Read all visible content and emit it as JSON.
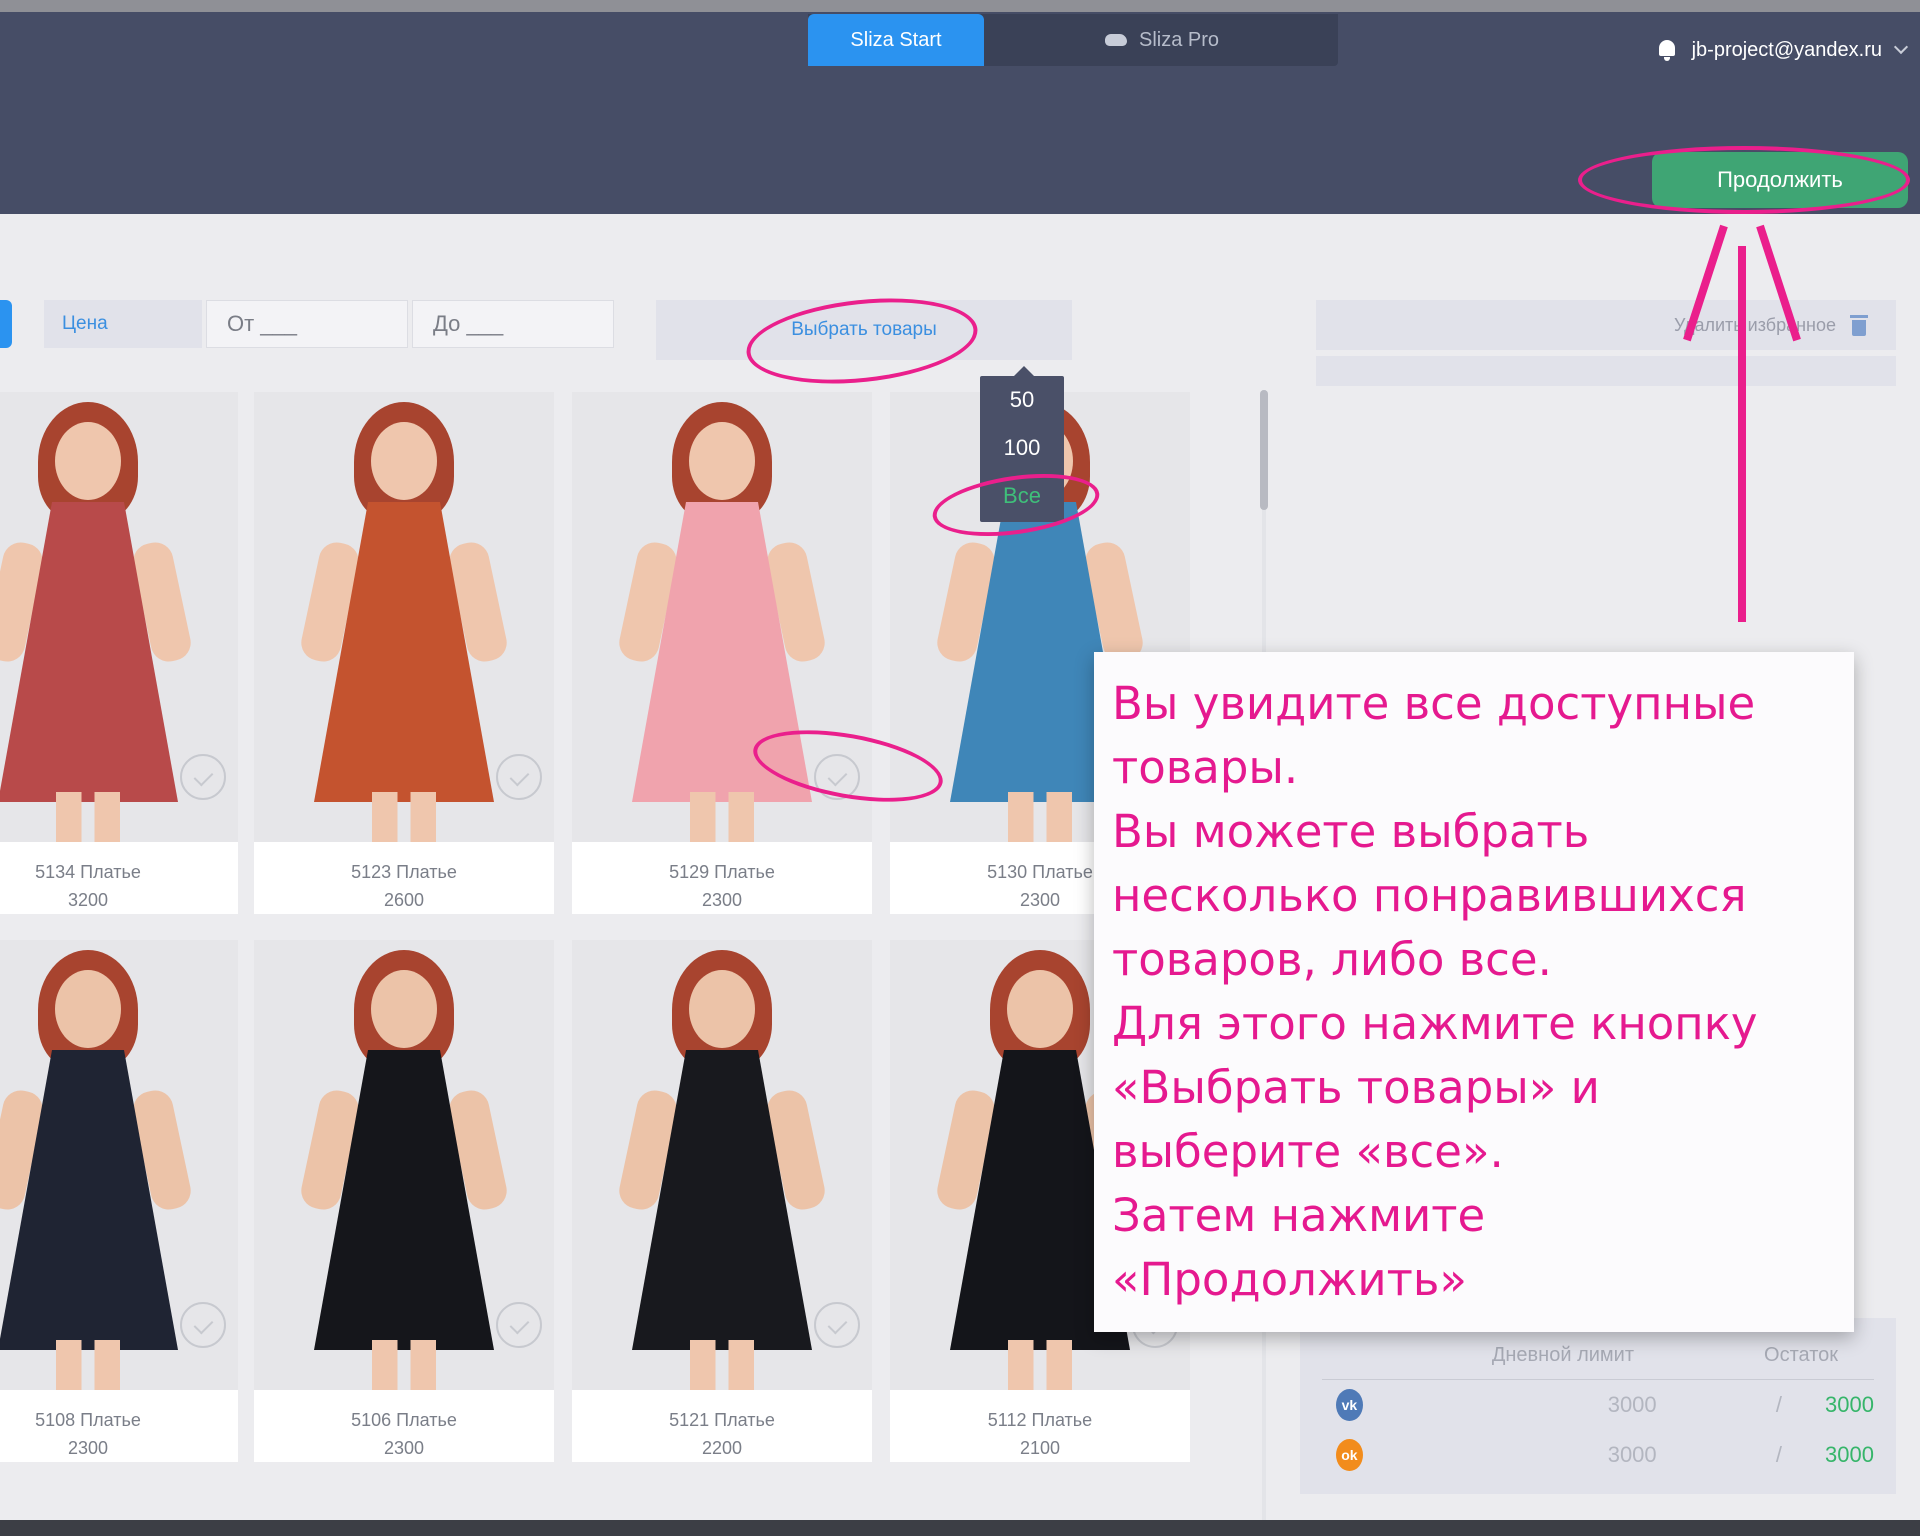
{
  "header": {
    "tabs": [
      {
        "label": "Sliza Start",
        "active": true
      },
      {
        "label": "Sliza Pro",
        "active": false,
        "icon": "cloud-icon"
      }
    ],
    "user_email": "jb-project@yandex.ru",
    "continue_label": "Продолжить"
  },
  "filters": {
    "price_label": "Цена",
    "from_placeholder": "От ___",
    "to_placeholder": "До ___",
    "select_products_label": "Выбрать товары"
  },
  "dropdown": {
    "options": [
      "50",
      "100",
      "Все"
    ],
    "selected": "Все"
  },
  "right_panel": {
    "delete_selected_label": "Удалить избранное"
  },
  "limits": {
    "col_daily": "Дневной лимит",
    "col_rest": "Остаток",
    "rows": [
      {
        "network": "vk-icon",
        "daily": "3000",
        "sep": "/",
        "rest": "3000"
      },
      {
        "network": "ok-icon",
        "daily": "3000",
        "sep": "/",
        "rest": "3000"
      }
    ]
  },
  "products": [
    {
      "name": "5134 Платье",
      "price": "3200",
      "color": "#b84a4a"
    },
    {
      "name": "5123 Платье",
      "price": "2600",
      "color": "#c4532f"
    },
    {
      "name": "5129 Платье",
      "price": "2300",
      "color": "#f0a3ad"
    },
    {
      "name": "5130 Платье",
      "price": "2300",
      "color": "#3f86b8"
    },
    {
      "name": "5108 Платье",
      "price": "2300",
      "color": "#1f2433"
    },
    {
      "name": "5106 Платье",
      "price": "2300",
      "color": "#15161b"
    },
    {
      "name": "5121 Платье",
      "price": "2200",
      "color": "#18191e"
    },
    {
      "name": "5112 Платье",
      "price": "2100",
      "color": "#14151a"
    }
  ],
  "callout": {
    "lines": [
      "Вы увидите все доступные",
      "товары.",
      "Вы можете выбрать",
      "несколько понравившихся",
      "товаров, либо все.",
      "Для этого нажмите кнопку",
      "«Выбрать товары» и",
      "выберите «все».",
      "Затем нажмите",
      "«Продолжить»"
    ]
  },
  "colors": {
    "header_bg": "#464d66",
    "accent_blue": "#2b93f0",
    "continue_green": "#3fa574",
    "annotation_pink": "#ea1f8c"
  }
}
